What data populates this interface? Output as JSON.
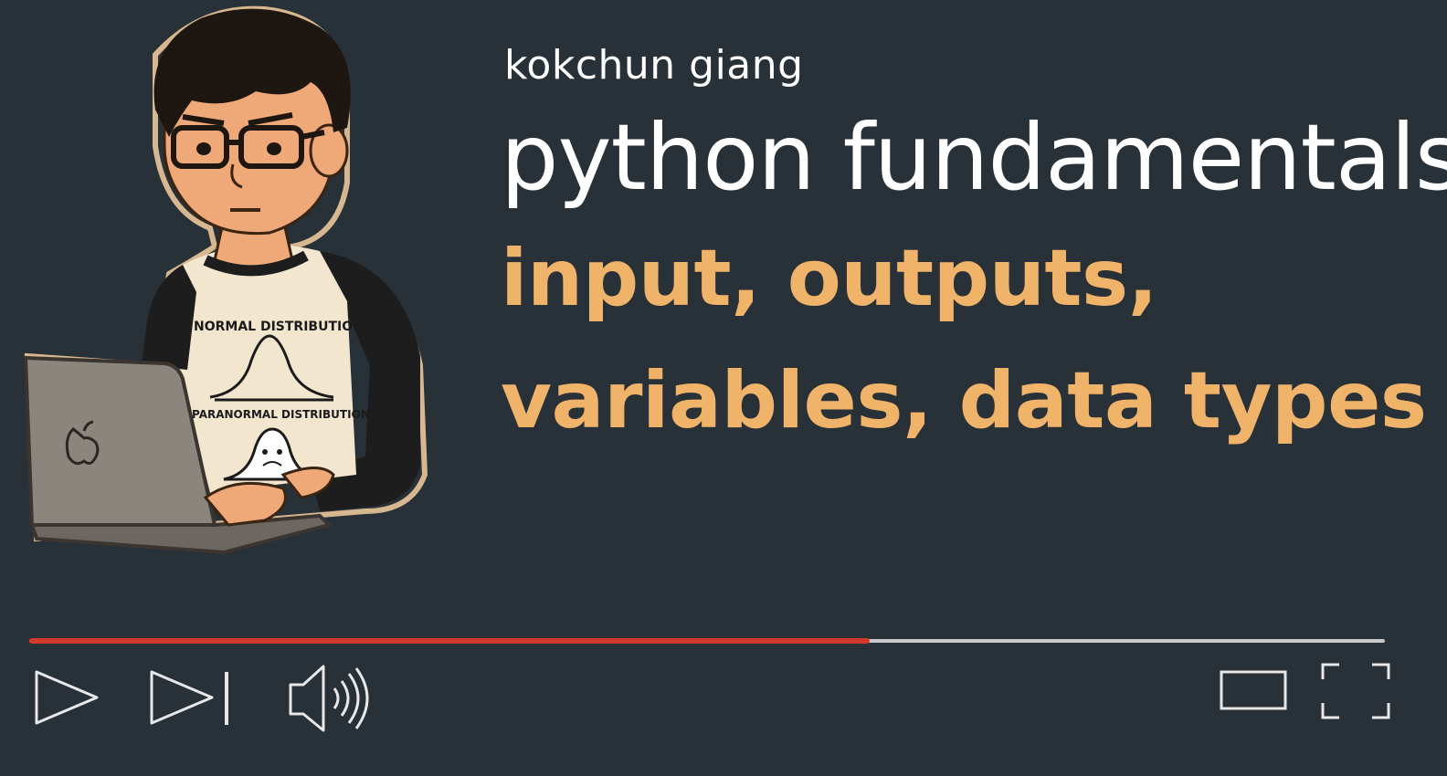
{
  "author": "kokchun giang",
  "course_title": "python fundamentals",
  "topic_lines": [
    "input, outputs,",
    "variables, data types"
  ],
  "illustration": {
    "shirt_top_text": "NORMAL DISTRIBUTION",
    "shirt_bottom_text": "PARANORMAL DISTRIBUTION"
  },
  "player": {
    "progress_fraction": 0.62,
    "progress_color": "#d2392b",
    "controls": [
      "play-icon",
      "skip-next-icon",
      "volume-icon",
      "theater-mode-icon",
      "fullscreen-icon"
    ]
  },
  "colors": {
    "background": "#283038",
    "title": "#ffffff",
    "accent": "#f0b36a"
  }
}
